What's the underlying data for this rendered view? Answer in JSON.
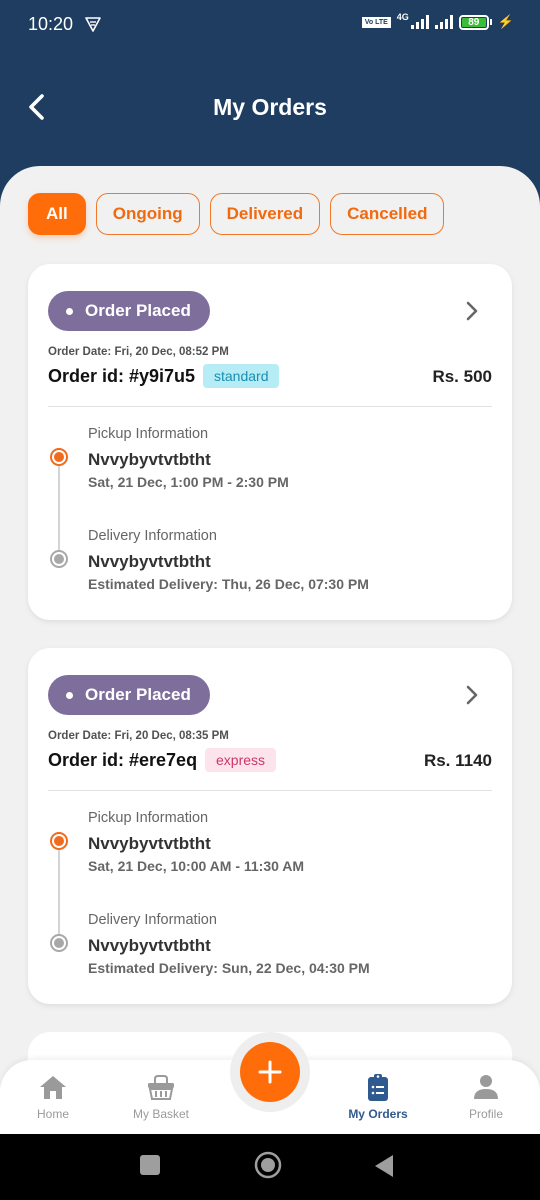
{
  "status_bar": {
    "time": "10:20",
    "volte": "Vo LTE",
    "network": "4G",
    "battery": "89"
  },
  "header": {
    "title": "My Orders",
    "back_icon": "chevron-left-icon"
  },
  "filters": [
    {
      "label": "All",
      "active": true
    },
    {
      "label": "Ongoing",
      "active": false
    },
    {
      "label": "Delivered",
      "active": false
    },
    {
      "label": "Cancelled",
      "active": false
    }
  ],
  "orders": [
    {
      "status": "Order Placed",
      "order_date": "Order Date: Fri, 20 Dec, 08:52 PM",
      "order_id": "Order id: #y9i7u5",
      "type": "standard",
      "type_color": "#1a8fb0",
      "type_bg": "#b5ecf5",
      "price": "Rs. 500",
      "pickup": {
        "label": "Pickup Information",
        "name": "Nvvybyvtvtbtht",
        "time": "Sat, 21 Dec, 1:00 PM - 2:30 PM"
      },
      "delivery": {
        "label": "Delivery Information",
        "name": "Nvvybyvtvtbtht",
        "time": "Estimated Delivery: Thu, 26 Dec, 07:30 PM"
      }
    },
    {
      "status": "Order Placed",
      "order_date": "Order Date: Fri, 20 Dec, 08:35 PM",
      "order_id": "Order id: #ere7eq",
      "type": "express",
      "type_color": "#c8386a",
      "type_bg": "#fde4ec",
      "price": "Rs. 1140",
      "pickup": {
        "label": "Pickup Information",
        "name": "Nvvybyvtvtbtht",
        "time": "Sat, 21 Dec, 10:00 AM - 11:30 AM"
      },
      "delivery": {
        "label": "Delivery Information",
        "name": "Nvvybyvtvtbtht",
        "time": "Estimated Delivery: Sun, 22 Dec, 04:30 PM"
      }
    }
  ],
  "bottom_nav": [
    {
      "label": "Home",
      "icon": "home-icon",
      "active": false
    },
    {
      "label": "My Basket",
      "icon": "basket-icon",
      "active": false
    },
    {
      "label": "My Orders",
      "icon": "clipboard-list-icon",
      "active": true
    },
    {
      "label": "Profile",
      "icon": "user-icon",
      "active": false
    }
  ],
  "fab": {
    "icon": "plus-icon"
  },
  "colors": {
    "primary": "#1e3d60",
    "accent": "#ff6d0a",
    "status_pill": "#7e6e9c",
    "nav_active": "#2f5a8f"
  }
}
